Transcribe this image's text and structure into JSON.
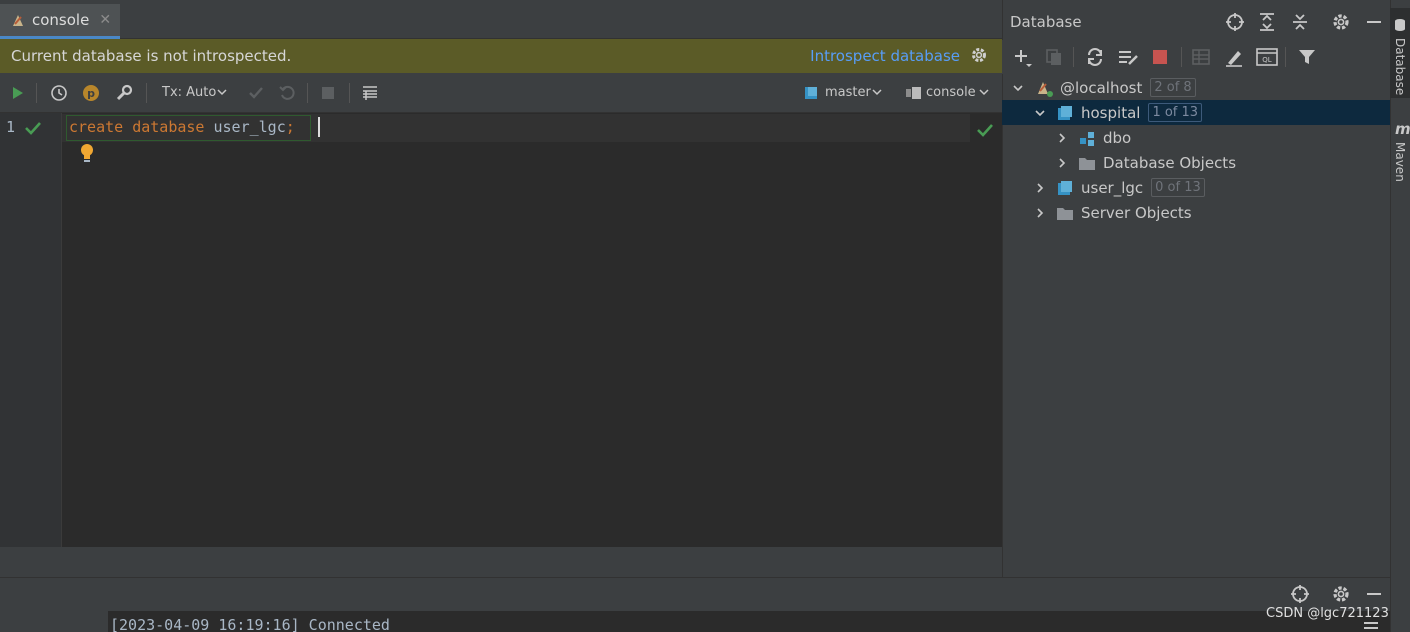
{
  "tabs": [
    {
      "label": "console"
    }
  ],
  "banner": {
    "message": "Current database is not introspected.",
    "link": "Introspect database"
  },
  "toolbar": {
    "tx_mode": "Tx: Auto",
    "schema_selector": "master",
    "session_selector": "console"
  },
  "editor": {
    "line_number": "1",
    "code": {
      "kw1": "create",
      "kw2": "database",
      "ident": "user_lgc",
      "terminator": ";"
    }
  },
  "database_panel": {
    "title": "Database",
    "tree": [
      {
        "label": "@localhost",
        "badge": "2 of 8"
      },
      {
        "label": "hospital",
        "badge": "1 of 13"
      },
      {
        "label": "dbo"
      },
      {
        "label": "Database Objects"
      },
      {
        "label": "user_lgc",
        "badge": "0 of 13"
      },
      {
        "label": "Server Objects"
      }
    ]
  },
  "side_stripe": {
    "database": "Database",
    "maven": "Maven",
    "maven_icon": "m"
  },
  "output": {
    "line": "[2023-04-09 16:19:16] Connected"
  },
  "watermark": "CSDN @lgc721123",
  "colors": {
    "accent": "#4a88c7",
    "banner": "#5b5b27",
    "keyword": "#cc7832",
    "link": "#589df6",
    "selection": "#0d293e",
    "run": "#499c54"
  }
}
